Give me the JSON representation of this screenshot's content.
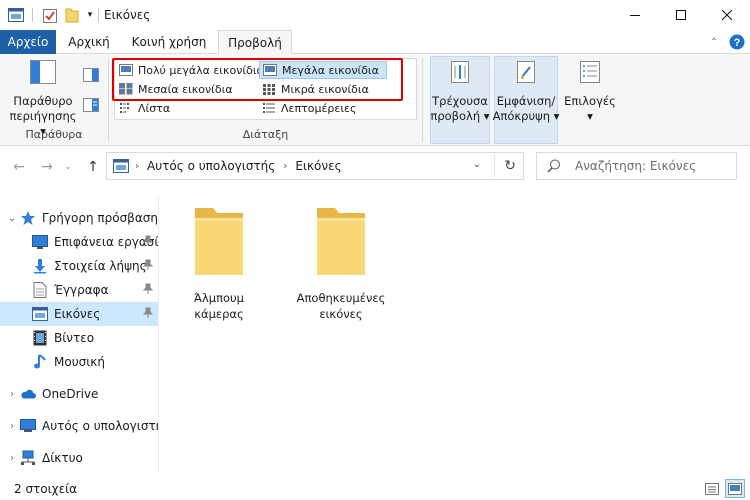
{
  "window": {
    "title": "Εικόνες",
    "controls": [
      "minimize",
      "maximize",
      "close"
    ]
  },
  "ribbon_tabs": [
    {
      "label": "Αρχείο",
      "active": false,
      "file": true
    },
    {
      "label": "Αρχική",
      "active": false
    },
    {
      "label": "Κοινή χρήση",
      "active": false
    },
    {
      "label": "Προβολή",
      "active": true
    }
  ],
  "ribbon": {
    "panes": {
      "navigation_pane_label_1": "Παράθυρο",
      "navigation_pane_label_2": "περιήγησης",
      "group_label": "Παράθυρα"
    },
    "layout": {
      "group_label": "Διάταξη",
      "items": [
        {
          "label": "Πολύ μεγάλα εικονίδια",
          "selected": false
        },
        {
          "label": "Μεγάλα εικονίδια",
          "selected": true
        },
        {
          "label": "Μεσαία εικονίδια",
          "selected": false
        },
        {
          "label": "Μικρά εικονίδια",
          "selected": false
        },
        {
          "label": "Λίστα",
          "selected": false
        },
        {
          "label": "Λεπτομέρειες",
          "selected": false
        }
      ]
    },
    "current_view": {
      "line1": "Τρέχουσα",
      "line2": "προβολή"
    },
    "show_hide": {
      "line1": "Εμφάνιση/",
      "line2": "Απόκρυψη"
    },
    "options": {
      "label": "Επιλογές"
    }
  },
  "address_bar": {
    "crumbs": [
      "Αυτός ο υπολογιστής",
      "Εικόνες"
    ]
  },
  "search": {
    "placeholder": "Αναζήτηση: Εικόνες"
  },
  "nav_pane": {
    "quick_access": "Γρήγορη πρόσβαση",
    "items": [
      {
        "label": "Επιφάνεια εργασίας",
        "pinned": true
      },
      {
        "label": "Στοιχεία λήψης",
        "pinned": true
      },
      {
        "label": "Έγγραφα",
        "pinned": true
      },
      {
        "label": "Εικόνες",
        "pinned": true,
        "selected": true
      },
      {
        "label": "Βίντεο",
        "pinned": false
      },
      {
        "label": "Μουσική",
        "pinned": false
      }
    ],
    "onedrive": "OneDrive",
    "this_pc": "Αυτός ο υπολογιστής",
    "network": "Δίκτυο"
  },
  "folders": [
    {
      "line1": "Άλμπουμ",
      "line2": "κάμερας"
    },
    {
      "line1": "Αποθηκευμένες",
      "line2": "εικόνες"
    }
  ],
  "status": {
    "count": "2 στοιχεία"
  },
  "colors": {
    "accent": "#1f5fa8",
    "selection": "#cce8ff",
    "highlight_box": "#e00000",
    "folder": "#f6d46c"
  }
}
